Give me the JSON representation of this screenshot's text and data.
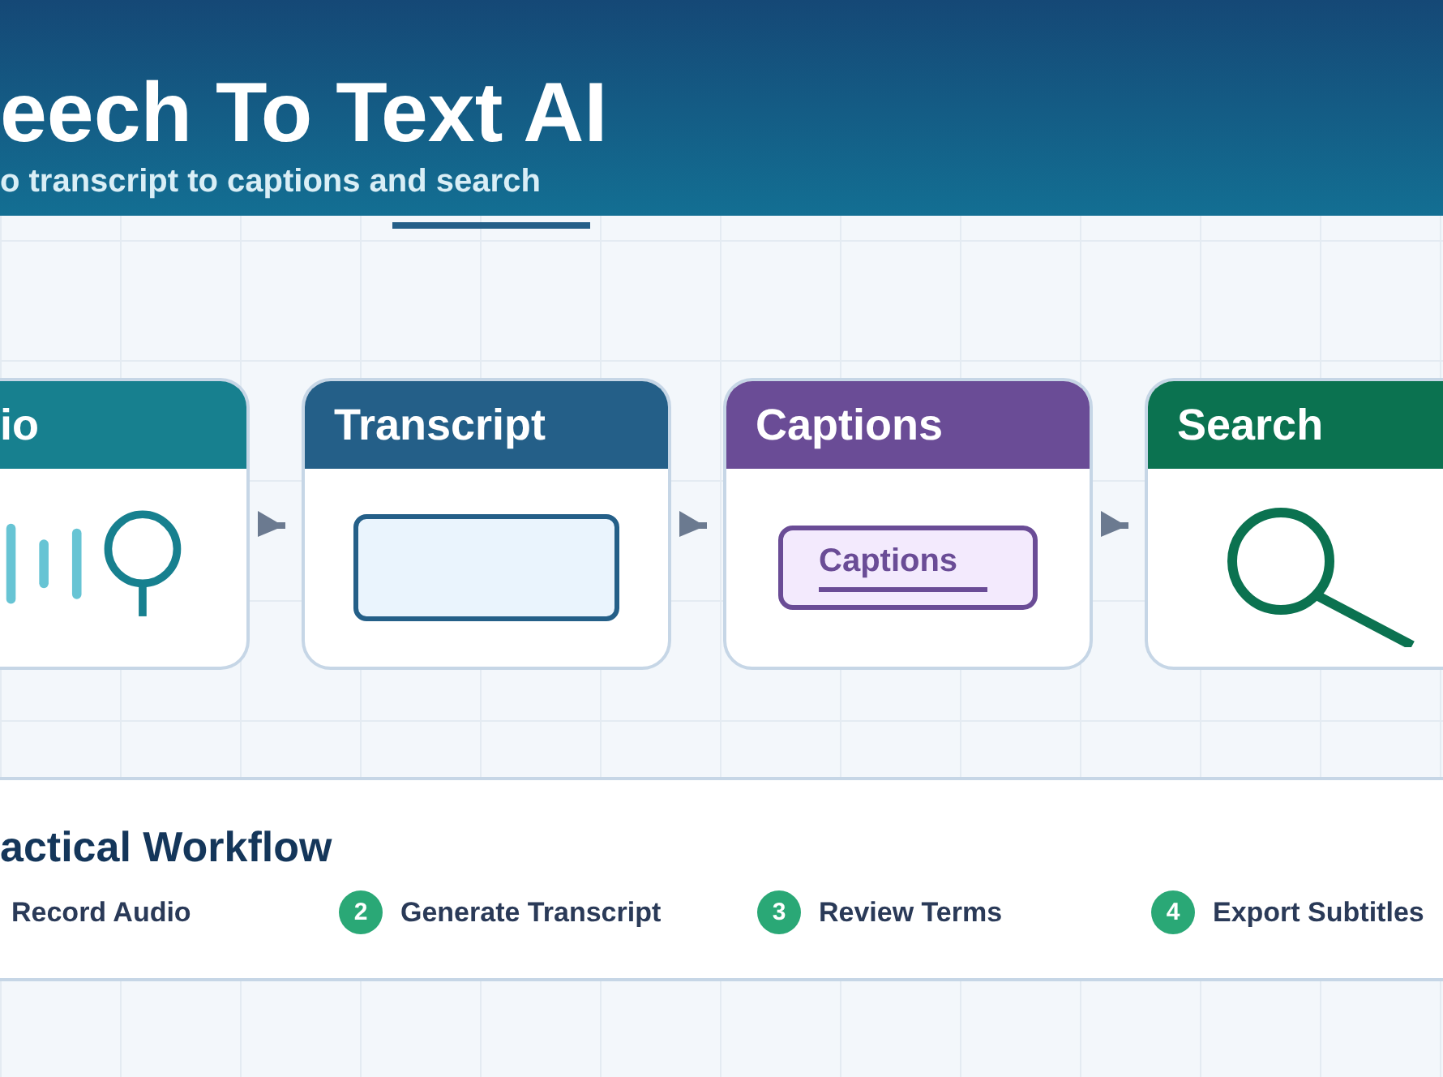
{
  "header": {
    "title": "eech To Text AI",
    "subtitle": "o transcript to captions and search"
  },
  "stages": [
    {
      "kind": "audio",
      "title": "io",
      "color": "#17808f",
      "cut_left": true
    },
    {
      "kind": "transcript",
      "title": "Transcript",
      "color": "#245f88",
      "cut_left": false
    },
    {
      "kind": "captions",
      "title": "Captions",
      "color": "#6a4c96",
      "caption": "Captions",
      "cut_left": false
    },
    {
      "kind": "search",
      "title": "Search",
      "color": "#0b7250",
      "cut_left": false
    }
  ],
  "workflow": {
    "title": "actical Workflow",
    "steps": [
      {
        "label": "Record Audio"
      },
      {
        "number": "2",
        "label": "Generate Transcript"
      },
      {
        "number": "3",
        "label": "Review Terms"
      },
      {
        "number": "4",
        "label": "Export Subtitles"
      }
    ]
  }
}
